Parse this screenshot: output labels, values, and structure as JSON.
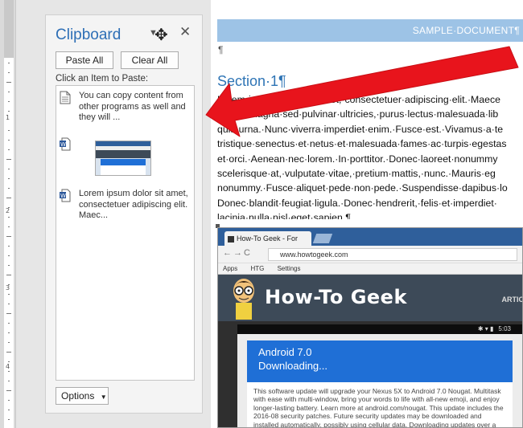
{
  "clipboard": {
    "title": "Clipboard",
    "paste_all": "Paste All",
    "clear_all": "Clear All",
    "instruction": "Click an Item to Paste:",
    "items": [
      {
        "type": "text",
        "icon": "document-icon",
        "text": "You can copy content from other programs as well and they will ..."
      },
      {
        "type": "image",
        "icon": "word-icon"
      },
      {
        "type": "text",
        "icon": "word-icon",
        "text": "Lorem ipsum dolor sit amet, consectetuer adipiscing elit. Maec..."
      }
    ],
    "options": "Options"
  },
  "document": {
    "header": "SAMPLE·DOCUMENT¶",
    "para_mark": "¶",
    "section_title": "Section·1¶",
    "body_lines": [
      "Lorem·ipsum·dolor·sit·amet,·consectetuer·adipiscing·elit.·Maece",
      "·porta,·magna·sed·pulvinar·ultricies,·purus·lectus·malesuada·lib",
      "quis·urna.·Nunc·viverra·imperdiet·enim.·Fusce·est.·Vivamus·a·te",
      "tristique·senectus·et·netus·et·malesuada·fames·ac·turpis·egestas",
      "et·orci.·Aenean·nec·lorem.·In·porttitor.·Donec·laoreet·nonummy",
      "scelerisque·at,·vulputate·vitae,·pretium·mattis,·nunc.·Mauris·eg",
      "nonummy.·Fusce·aliquet·pede·non·pede.·Suspendisse·dapibus·lo",
      "Donec·blandit·feugiat·ligula.·Donec·hendrerit,·felis·et·imperdiet·",
      "lacinia·nulla·nisl·eget·sapien.¶"
    ]
  },
  "browser": {
    "tab_title": "How-To Geek - For Geeks",
    "url": "www.howtogeek.com",
    "bookmarks": [
      "Apps",
      "HTG",
      "Settings"
    ],
    "site_logo": "How-To Geek",
    "nav_item": "ARTIC",
    "phone_time": "5:03",
    "update_title": "Android 7.0",
    "update_status": "Downloading...",
    "update_desc": "This software update will upgrade your Nexus 5X to Android 7.0 Nougat. Multitask with ease with multi-window, bring your words to life with all-new emoji, and enjoy longer-lasting battery. Learn more at android.com/nougat. This update includes the 2016-08 security patches. Future security updates may be downloaded and installed automatically, possibly using cellular data. Downloading updates over a cellular network or while roaming may cause additional"
  },
  "colors": {
    "accent": "#2e6fb6",
    "header_bar": "#9dc3e6",
    "arrow": "#e8141c",
    "htg_banner": "#3d4a58",
    "update_blue": "#1f6fd6"
  }
}
